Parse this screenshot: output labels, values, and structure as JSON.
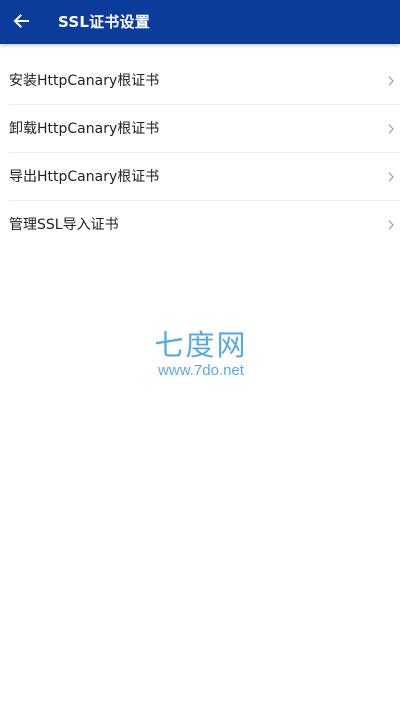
{
  "app_bar": {
    "title": "SSL证书设置",
    "background_color": "#0c3c9b",
    "back_icon": "arrow-left-icon"
  },
  "settings": {
    "items": [
      {
        "label": "安装HttpCanary根证书",
        "icon": "chevron-right-icon"
      },
      {
        "label": "卸载HttpCanary根证书",
        "icon": "chevron-right-icon"
      },
      {
        "label": "导出HttpCanary根证书",
        "icon": "chevron-right-icon"
      },
      {
        "label": "管理SSL导入证书",
        "icon": "chevron-right-icon"
      }
    ]
  },
  "watermark": {
    "logo_text": "七度网",
    "url": "www.7do.net",
    "color": "#3b9be0"
  }
}
